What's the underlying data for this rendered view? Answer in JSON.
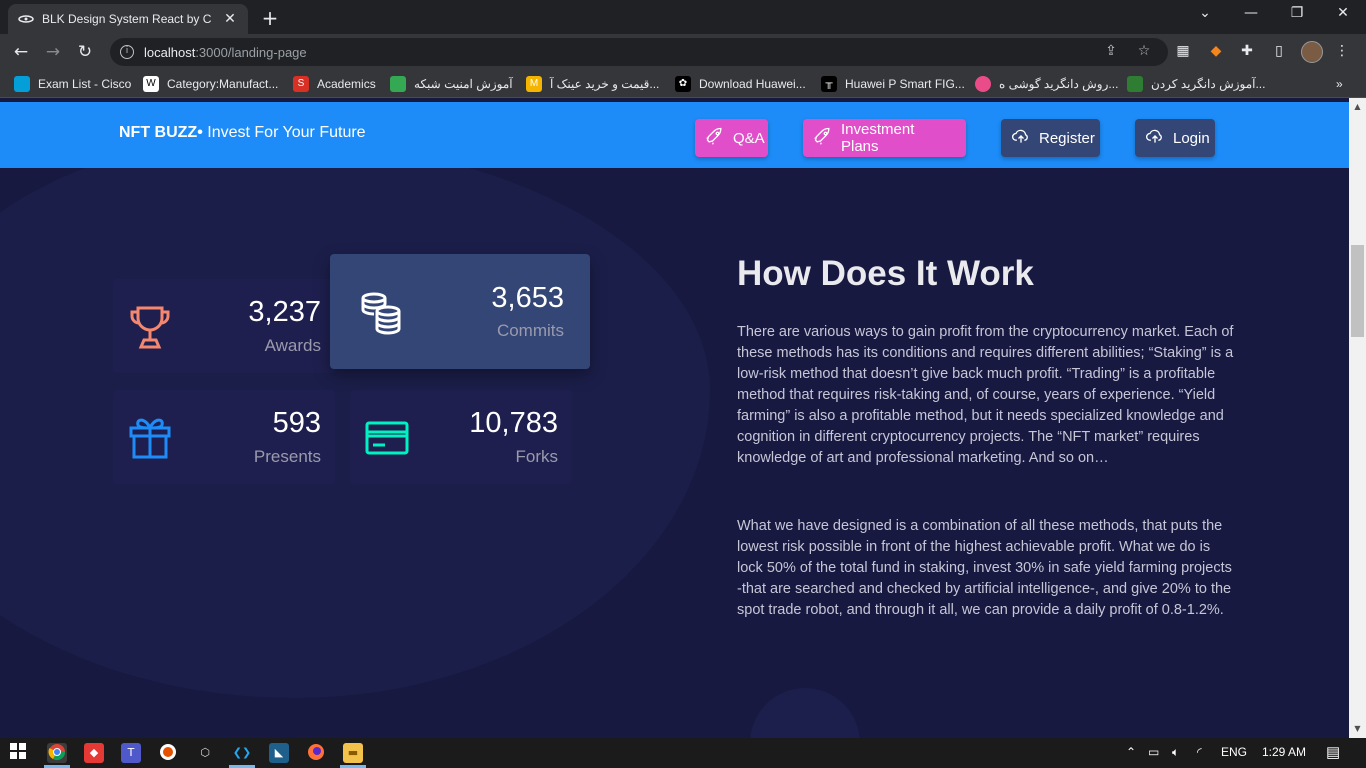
{
  "browser": {
    "tab_title": "BLK Design System React by Crea",
    "url_host": "localhost",
    "url_path": ":3000/landing-page",
    "bookmarks": [
      {
        "label": "Exam List - Cisco",
        "icon": "cisco-icon",
        "color": "#049fd9"
      },
      {
        "label": "Category:Manufact...",
        "icon": "wikipedia-icon",
        "color": "#ffffff"
      },
      {
        "label": "Academics",
        "icon": "s-logo-icon",
        "color": "#d93025"
      },
      {
        "label": "آموزش امنیت شبکه",
        "icon": "green-logo-icon",
        "color": "#34a853"
      },
      {
        "label": "قیمت و خرید عینک آ...",
        "icon": "m-logo-icon",
        "color": "#f4b400"
      },
      {
        "label": "Download Huawei...",
        "icon": "huawei-icon",
        "color": "#000000"
      },
      {
        "label": "Huawei P Smart FIG...",
        "icon": "tool-icon",
        "color": "#000000"
      },
      {
        "label": "روش دانگرید گوشی ه...",
        "icon": "dribbble-icon",
        "color": "#ea4c89"
      },
      {
        "label": "آموزش دانگرید کردن...",
        "icon": "site-icon",
        "color": "#2e7d32"
      }
    ]
  },
  "navbar": {
    "brand_bold": "NFT BUZZ•",
    "brand_rest": " Invest For Your Future",
    "qa_label": "Q&A",
    "plans_label": "Investment Plans",
    "register_label": "Register",
    "login_label": "Login"
  },
  "stats": [
    {
      "value": "3,237",
      "label": "Awards",
      "icon": "trophy-icon",
      "color": "#f5876e"
    },
    {
      "value": "3,653",
      "label": "Commits",
      "icon": "coins-icon",
      "color": "#ffffff"
    },
    {
      "value": "593",
      "label": "Presents",
      "icon": "gift-icon",
      "color": "#1d8cf8"
    },
    {
      "value": "10,783",
      "label": "Forks",
      "icon": "credit-card-icon",
      "color": "#00f2c3"
    }
  ],
  "content": {
    "heading": "How Does It Work",
    "paragraph1": "There are various ways to gain profit from the cryptocurrency market. Each of these methods has its conditions and requires different abilities; “Staking” is a low-risk method that doesn’t give back much profit. “Trading” is a profitable method that requires risk-taking and, of course, years of experience. “Yield farming” is also a profitable method, but it needs specialized knowledge and cognition in different cryptocurrency projects. The “NFT market” requires knowledge of art and professional marketing. And so on…",
    "paragraph2": "What we have designed is a combination of all these methods, that puts the lowest risk possible in front of the highest achievable profit. What we do is lock 50% of the total fund in staking, invest 30% in safe yield farming projects -that are searched and checked by artificial intelligence-, and give 20% to the spot trade robot, and through it all, we can provide a daily profit of 0.8-1.2%."
  },
  "taskbar": {
    "language": "ENG",
    "time": "1:29 AM"
  }
}
